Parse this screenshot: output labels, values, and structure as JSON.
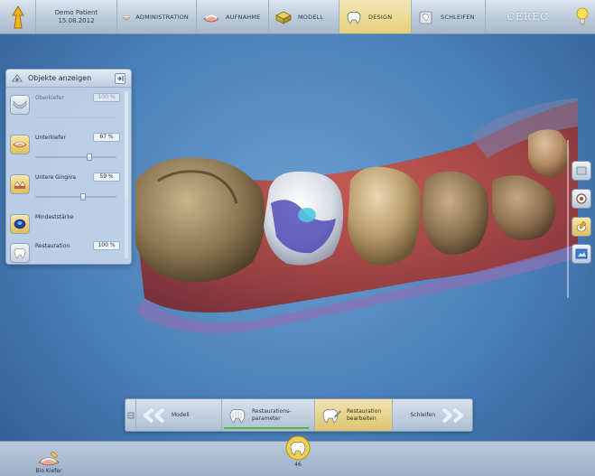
{
  "patient": {
    "name": "Demo Patient",
    "date": "15.08.2012"
  },
  "phases": [
    {
      "label": "ADMINISTRATION",
      "icon": "patient-file-icon",
      "active": false
    },
    {
      "label": "AUFNAHME",
      "icon": "scan-jaw-icon",
      "active": false
    },
    {
      "label": "MODELL",
      "icon": "model-icon",
      "active": false
    },
    {
      "label": "DESIGN",
      "icon": "crown-design-icon",
      "active": true
    },
    {
      "label": "SCHLEIFEN",
      "icon": "milling-icon",
      "active": false
    }
  ],
  "brand": "CEREC",
  "objects_panel": {
    "title": "Objekte anzeigen",
    "items": [
      {
        "label": "Oberkiefer",
        "value": "100 %",
        "level": 1.0,
        "enabled": false
      },
      {
        "label": "Unterkiefer",
        "value": "67 %",
        "level": 0.67,
        "enabled": true
      },
      {
        "label": "Untere Gingiva",
        "value": "59 %",
        "level": 0.59,
        "enabled": true
      },
      {
        "label": "Mindeststärke",
        "value": "",
        "enabled": true
      },
      {
        "label": "Restauration",
        "value": "100 %",
        "enabled": true
      }
    ]
  },
  "workflow": {
    "prev_label": "Modell",
    "step1_label_line1": "Restaurations-",
    "step1_label_line2": "parameter",
    "step2_label_line1": "Restauration",
    "step2_label_line2": "bearbeiten",
    "next_label": "Schleifen"
  },
  "bottom": {
    "bio_label": "Bio Kiefer",
    "tooth_number": "46"
  },
  "colors": {
    "active_phase": "#e6cf78",
    "background": "#4a7fb8",
    "progress_green": "#4ebd3a"
  }
}
